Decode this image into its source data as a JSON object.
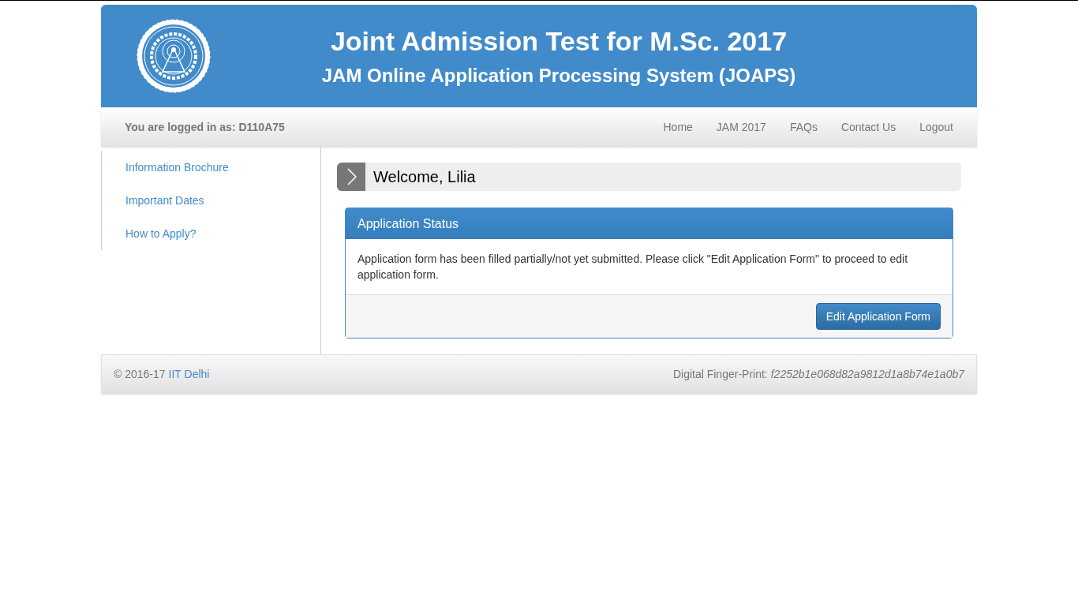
{
  "header": {
    "title": "Joint Admission Test for M.Sc. 2017",
    "subtitle": "JAM Online Application Processing System (JOAPS)"
  },
  "navbar": {
    "login_text": "You are logged in as: D110A75",
    "links": [
      "Home",
      "JAM 2017",
      "FAQs",
      "Contact Us",
      "Logout"
    ]
  },
  "sidebar": {
    "items": [
      "Information Brochure",
      "Important Dates",
      "How to Apply?"
    ]
  },
  "welcome": {
    "text": "Welcome, Lilia"
  },
  "panel": {
    "title": "Application Status",
    "message": "Application form has been filled partially/not yet submitted. Please click \"Edit Application Form\" to proceed to edit application form.",
    "button": "Edit Application Form"
  },
  "footer": {
    "copyright": "© 2016-17",
    "link": "IIT Delhi",
    "fingerprint_label": "Digital Finger-Print:",
    "fingerprint": "f2252b1e068d82a9812d1a8b74e1a0b7"
  }
}
